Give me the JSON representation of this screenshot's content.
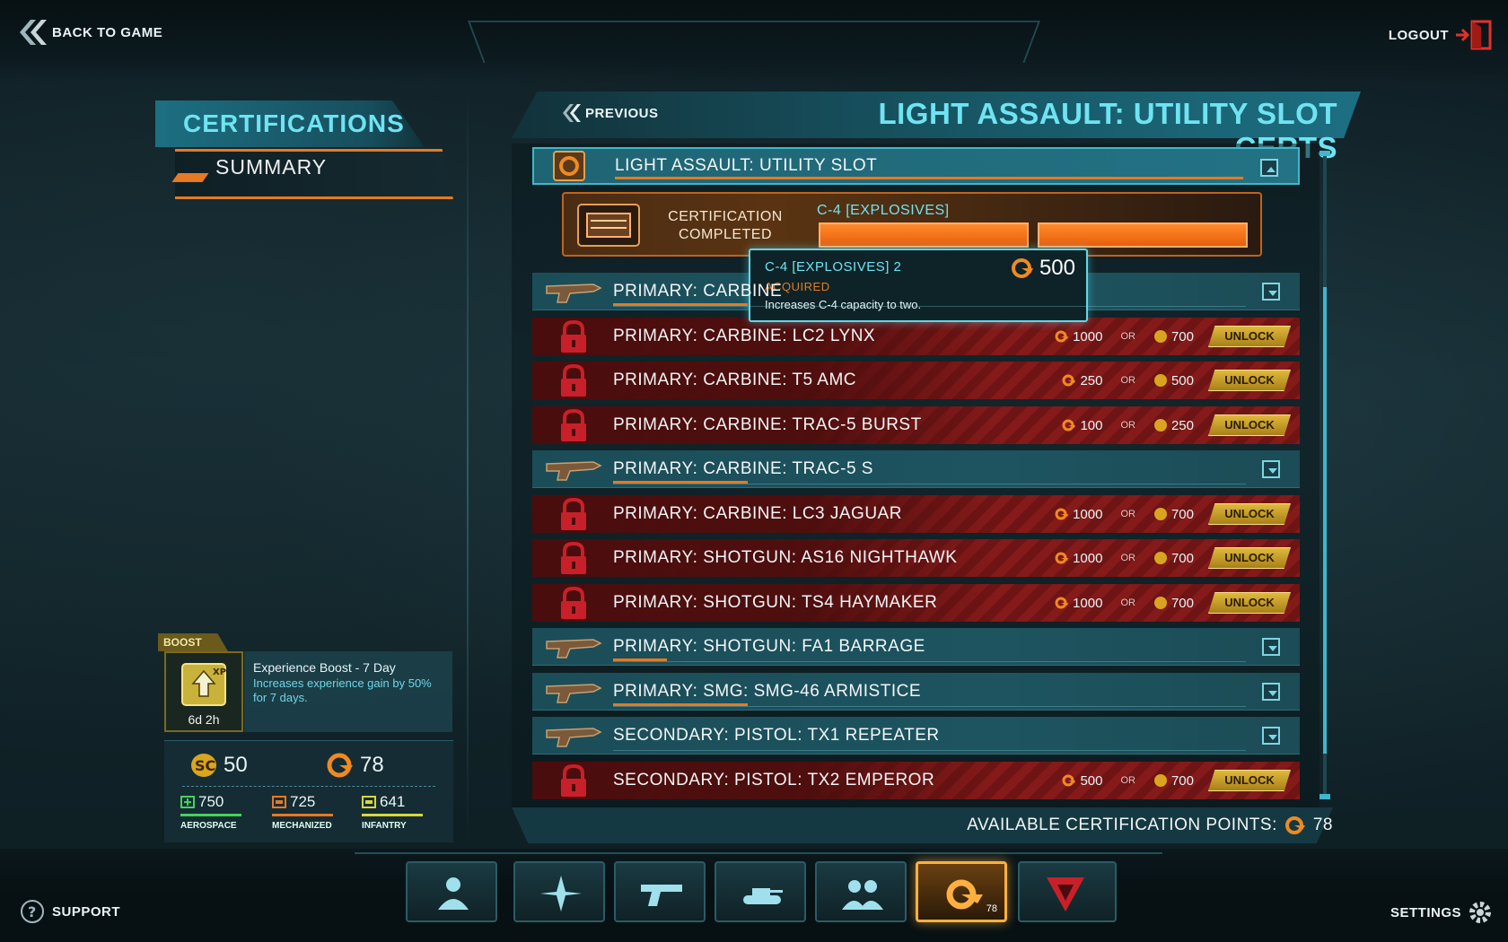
{
  "top": {
    "back_label": "BACK TO GAME",
    "logout_label": "LOGOUT"
  },
  "sidebar": {
    "title": "CERTIFICATIONS",
    "summary_label": "SUMMARY"
  },
  "boost": {
    "tag": "BOOST",
    "time_left": "6d 2h",
    "name": "Experience Boost - 7 Day",
    "description": "Increases experience gain by 50% for 7 days."
  },
  "currency": {
    "daybreak_cash": "50",
    "cert_points": "78",
    "resources": [
      {
        "name": "AEROSPACE",
        "value": "750",
        "color": "#43d35a"
      },
      {
        "name": "MECHANIZED",
        "value": "725",
        "color": "#e67a22"
      },
      {
        "name": "INFANTRY",
        "value": "641",
        "color": "#d8d83a"
      }
    ]
  },
  "main": {
    "previous_label": "PREVIOUS",
    "title": "LIGHT ASSAULT: UTILITY SLOT CERTS",
    "available_label": "AVAILABLE CERTIFICATION POINTS:",
    "available_value": "78"
  },
  "expanded_row": {
    "label": "LIGHT ASSAULT: UTILITY SLOT",
    "sub": {
      "status": "CERTIFICATION COMPLETED",
      "status_line1": "CERTIFICATION",
      "status_line2": "COMPLETED",
      "name": "C-4 [EXPLOSIVES]"
    }
  },
  "tooltip": {
    "name": "C-4 [EXPLOSIVES] 2",
    "status": "ACQUIRED",
    "description": "Increases C-4 capacity to two.",
    "cost": "500"
  },
  "rows": [
    {
      "label": "PRIMARY: CARBINE",
      "type": "owned",
      "progress": 0.2
    },
    {
      "label": "PRIMARY: CARBINE: LC2 LYNX",
      "type": "locked",
      "cert_cost": "1000",
      "or": "OR",
      "cash_cost": "700",
      "unlock": "UNLOCK"
    },
    {
      "label": "PRIMARY: CARBINE: T5 AMC",
      "type": "locked",
      "cert_cost": "250",
      "or": "OR",
      "cash_cost": "500",
      "unlock": "UNLOCK"
    },
    {
      "label": "PRIMARY: CARBINE: TRAC-5 BURST",
      "type": "locked",
      "cert_cost": "100",
      "or": "OR",
      "cash_cost": "250",
      "unlock": "UNLOCK"
    },
    {
      "label": "PRIMARY: CARBINE: TRAC-5 S",
      "type": "owned",
      "progress": 0.2
    },
    {
      "label": "PRIMARY: CARBINE: LC3 JAGUAR",
      "type": "locked",
      "cert_cost": "1000",
      "or": "OR",
      "cash_cost": "700",
      "unlock": "UNLOCK"
    },
    {
      "label": "PRIMARY: SHOTGUN: AS16 NIGHTHAWK",
      "type": "locked",
      "cert_cost": "1000",
      "or": "OR",
      "cash_cost": "700",
      "unlock": "UNLOCK"
    },
    {
      "label": "PRIMARY: SHOTGUN: TS4 HAYMAKER",
      "type": "locked",
      "cert_cost": "1000",
      "or": "OR",
      "cash_cost": "700",
      "unlock": "UNLOCK"
    },
    {
      "label": "PRIMARY: SHOTGUN: FA1 BARRAGE",
      "type": "owned",
      "progress": 0.08
    },
    {
      "label": "PRIMARY: SMG: SMG-46 ARMISTICE",
      "type": "owned",
      "progress": 0.2
    },
    {
      "label": "SECONDARY: PISTOL: TX1 REPEATER",
      "type": "owned",
      "progress": 0
    },
    {
      "label": "SECONDARY: PISTOL: TX2 EMPEROR",
      "type": "locked",
      "cert_cost": "500",
      "or": "OR",
      "cash_cost": "700",
      "unlock": "UNLOCK"
    }
  ],
  "nav": {
    "items": [
      "character-icon",
      "map-compass-icon",
      "pistol-icon",
      "tank-icon",
      "squad-icon",
      "cert-icon",
      "outfit-icon"
    ],
    "cert_badge": "78"
  },
  "bottom": {
    "support_label": "SUPPORT",
    "settings_label": "SETTINGS"
  }
}
